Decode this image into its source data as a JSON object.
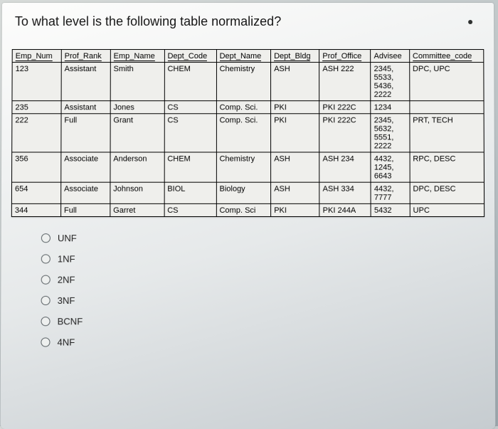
{
  "question": "To what level is the following table normalized?",
  "headers": [
    "Emp_Num",
    "Prof_Rank",
    "Emp_Name",
    "Dept_Code",
    "Dept_Name",
    "Dept_Bldg",
    "Prof_Office",
    "Advisee",
    "Committee_code"
  ],
  "rows": [
    {
      "emp_num": "123",
      "prof_rank": "Assistant",
      "emp_name": "Smith",
      "dept_code": "CHEM",
      "dept_name": "Chemistry",
      "dept_bldg": "ASH",
      "prof_office": "ASH 222",
      "advisee": "2345, 5533, 5436, 2222",
      "committee": "DPC, UPC"
    },
    {
      "emp_num": "235",
      "prof_rank": "Assistant",
      "emp_name": "Jones",
      "dept_code": "CS",
      "dept_name": "Comp. Sci.",
      "dept_bldg": "PKI",
      "prof_office": "PKI 222C",
      "advisee": "1234",
      "committee": ""
    },
    {
      "emp_num": "222",
      "prof_rank": "Full",
      "emp_name": "Grant",
      "dept_code": "CS",
      "dept_name": "Comp. Sci.",
      "dept_bldg": "PKI",
      "prof_office": "PKI 222C",
      "advisee": "2345, 5632, 5551, 2222",
      "committee": "PRT, TECH"
    },
    {
      "emp_num": "356",
      "prof_rank": "Associate",
      "emp_name": "Anderson",
      "dept_code": "CHEM",
      "dept_name": "Chemistry",
      "dept_bldg": "ASH",
      "prof_office": "ASH 234",
      "advisee": "4432, 1245, 6643",
      "committee": "RPC, DESC"
    },
    {
      "emp_num": "654",
      "prof_rank": "Associate",
      "emp_name": "Johnson",
      "dept_code": "BIOL",
      "dept_name": "Biology",
      "dept_bldg": "ASH",
      "prof_office": "ASH 334",
      "advisee": "4432, 7777",
      "committee": "DPC, DESC"
    },
    {
      "emp_num": "344",
      "prof_rank": "Full",
      "emp_name": "Garret",
      "dept_code": "CS",
      "dept_name": "Comp. Sci",
      "dept_bldg": "PKI",
      "prof_office": "PKI 244A",
      "advisee": "5432",
      "committee": "UPC"
    }
  ],
  "options": [
    "UNF",
    "1NF",
    "2NF",
    "3NF",
    "BCNF",
    "4NF"
  ]
}
